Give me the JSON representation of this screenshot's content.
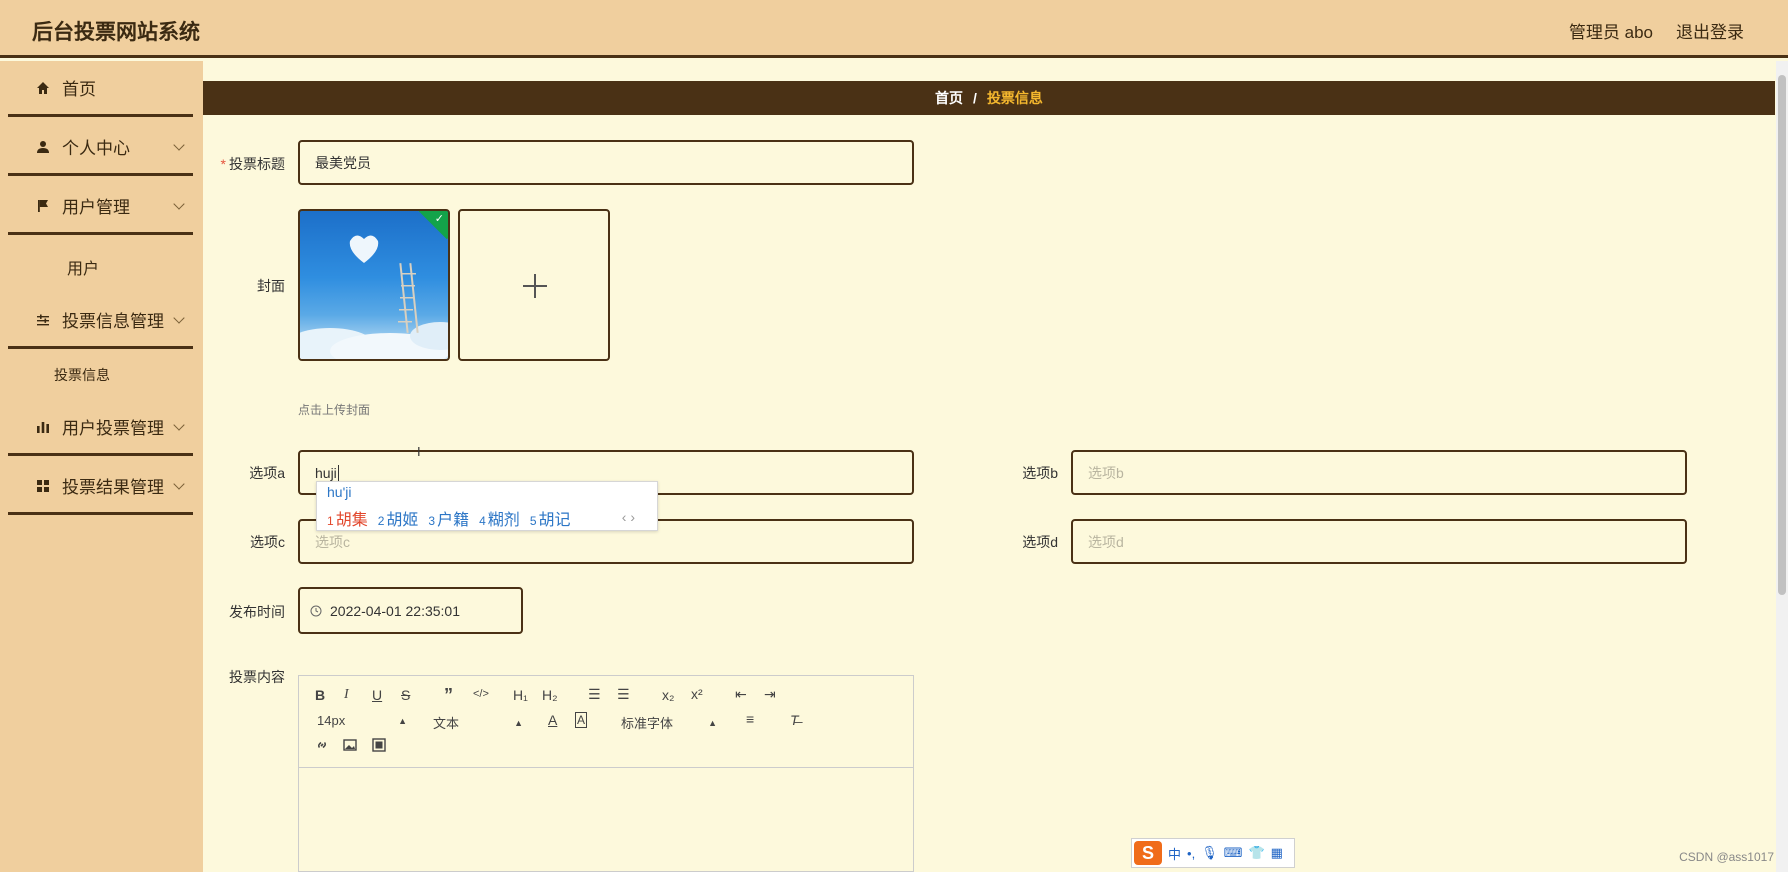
{
  "header": {
    "title": "后台投票网站系统",
    "user_label": "管理员 abo",
    "logout_label": "退出登录"
  },
  "sidebar": {
    "items": [
      {
        "label": "首页",
        "icon": "home-icon"
      },
      {
        "label": "个人中心",
        "icon": "user-icon"
      },
      {
        "label": "用户管理",
        "icon": "flag-icon"
      },
      {
        "label": "投票信息管理",
        "icon": "sliders-icon"
      },
      {
        "label": "用户投票管理",
        "icon": "bar-chart-icon"
      },
      {
        "label": "投票结果管理",
        "icon": "grid-icon"
      }
    ],
    "subitems": {
      "users": "用户",
      "vote_info": "投票信息"
    }
  },
  "breadcrumb": {
    "home": "首页",
    "separator": "/",
    "current": "投票信息"
  },
  "form": {
    "title_label": "投票标题",
    "title_value": "最美党员",
    "cover_label": "封面",
    "cover_hint": "点击上传封面",
    "option_a_label": "选项a",
    "option_a_value": "huji",
    "option_b_label": "选项b",
    "option_b_placeholder": "选项b",
    "option_c_label": "选项c",
    "option_c_placeholder": "选项c",
    "option_d_label": "选项d",
    "option_d_placeholder": "选项d",
    "publish_time_label": "发布时间",
    "publish_time_value": "2022-04-01 22:35:01",
    "content_label": "投票内容"
  },
  "ime": {
    "pinyin": "hu'ji",
    "candidates": [
      {
        "num": "1",
        "text": "胡集"
      },
      {
        "num": "2",
        "text": "胡姬"
      },
      {
        "num": "3",
        "text": "户籍"
      },
      {
        "num": "4",
        "text": "糊剂"
      },
      {
        "num": "5",
        "text": "胡记"
      }
    ],
    "nav": "‹ ›",
    "bar_mode": "中"
  },
  "editor": {
    "font_size": "14px",
    "paragraph": "文本",
    "font_family": "标准字体"
  },
  "watermark": "CSDN @ass1017",
  "colors": {
    "header_bg": "#f0cf9e",
    "brown": "#4a3115",
    "accent": "#f5b82e",
    "main_bg": "#fdf9dc"
  }
}
